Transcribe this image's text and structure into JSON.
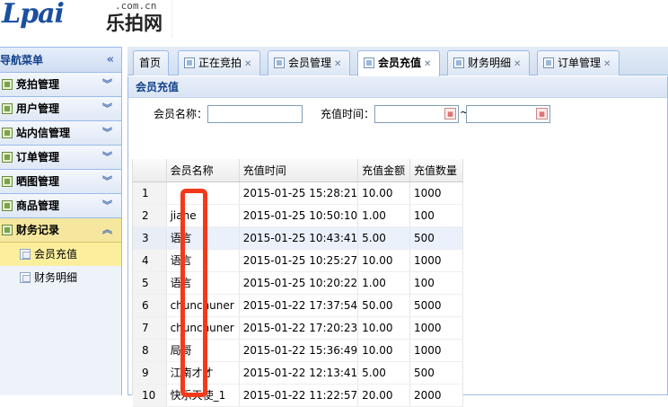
{
  "logo": {
    "mark": "Lpai",
    "cn": "乐拍网",
    "domain": ".com.cn"
  },
  "sidebar": {
    "title": "导航菜单",
    "sections": [
      {
        "label": "竞拍管理"
      },
      {
        "label": "用户管理"
      },
      {
        "label": "站内信管理"
      },
      {
        "label": "订单管理"
      },
      {
        "label": "晒图管理"
      },
      {
        "label": "商品管理"
      },
      {
        "label": "财务记录"
      }
    ],
    "sub_items": [
      {
        "label": "会员充值"
      },
      {
        "label": "财务明细"
      }
    ]
  },
  "tabs": [
    {
      "label": "首页"
    },
    {
      "label": "正在竞拍"
    },
    {
      "label": "会员管理"
    },
    {
      "label": "会员充值"
    },
    {
      "label": "财务明细"
    },
    {
      "label": "订单管理"
    }
  ],
  "panel": {
    "title": "会员充值",
    "member_name_label": "会员名称：",
    "member_name_value": "",
    "time_label": "充值时间：",
    "time_from": "",
    "time_to": "",
    "range_sep": "~"
  },
  "grid": {
    "columns": [
      "",
      "会员名称",
      "充值时间",
      "充值金额",
      "充值数量"
    ],
    "rows": [
      {
        "n": "1",
        "name": "",
        "time": "2015-01-25 15:28:21",
        "amount": "10.00",
        "qty": "1000"
      },
      {
        "n": "2",
        "name": "jiahe",
        "time": "2015-01-25 10:50:10",
        "amount": "1.00",
        "qty": "100"
      },
      {
        "n": "3",
        "name": "语言",
        "time": "2015-01-25 10:43:41",
        "amount": "5.00",
        "qty": "500"
      },
      {
        "n": "4",
        "name": "语言",
        "time": "2015-01-25 10:25:27",
        "amount": "10.00",
        "qty": "1000"
      },
      {
        "n": "5",
        "name": "语言",
        "time": "2015-01-25 10:20:22",
        "amount": "1.00",
        "qty": "100"
      },
      {
        "n": "6",
        "name": "chunchuner",
        "time": "2015-01-22 17:37:54",
        "amount": "50.00",
        "qty": "5000"
      },
      {
        "n": "7",
        "name": "chunchuner",
        "time": "2015-01-22 17:20:23",
        "amount": "10.00",
        "qty": "1000"
      },
      {
        "n": "8",
        "name": "局哥",
        "time": "2015-01-22 15:36:49",
        "amount": "10.00",
        "qty": "1000"
      },
      {
        "n": "9",
        "name": "江南才才",
        "time": "2015-01-22 12:13:41",
        "amount": "5.00",
        "qty": "500"
      },
      {
        "n": "10",
        "name": "快乐天使_1",
        "time": "2015-01-22 11:22:57",
        "amount": "20.00",
        "qty": "2000"
      }
    ]
  },
  "colors": {
    "accent": "#15428b",
    "highlight": "#fbef9e",
    "annotation": "#f23a1a"
  }
}
